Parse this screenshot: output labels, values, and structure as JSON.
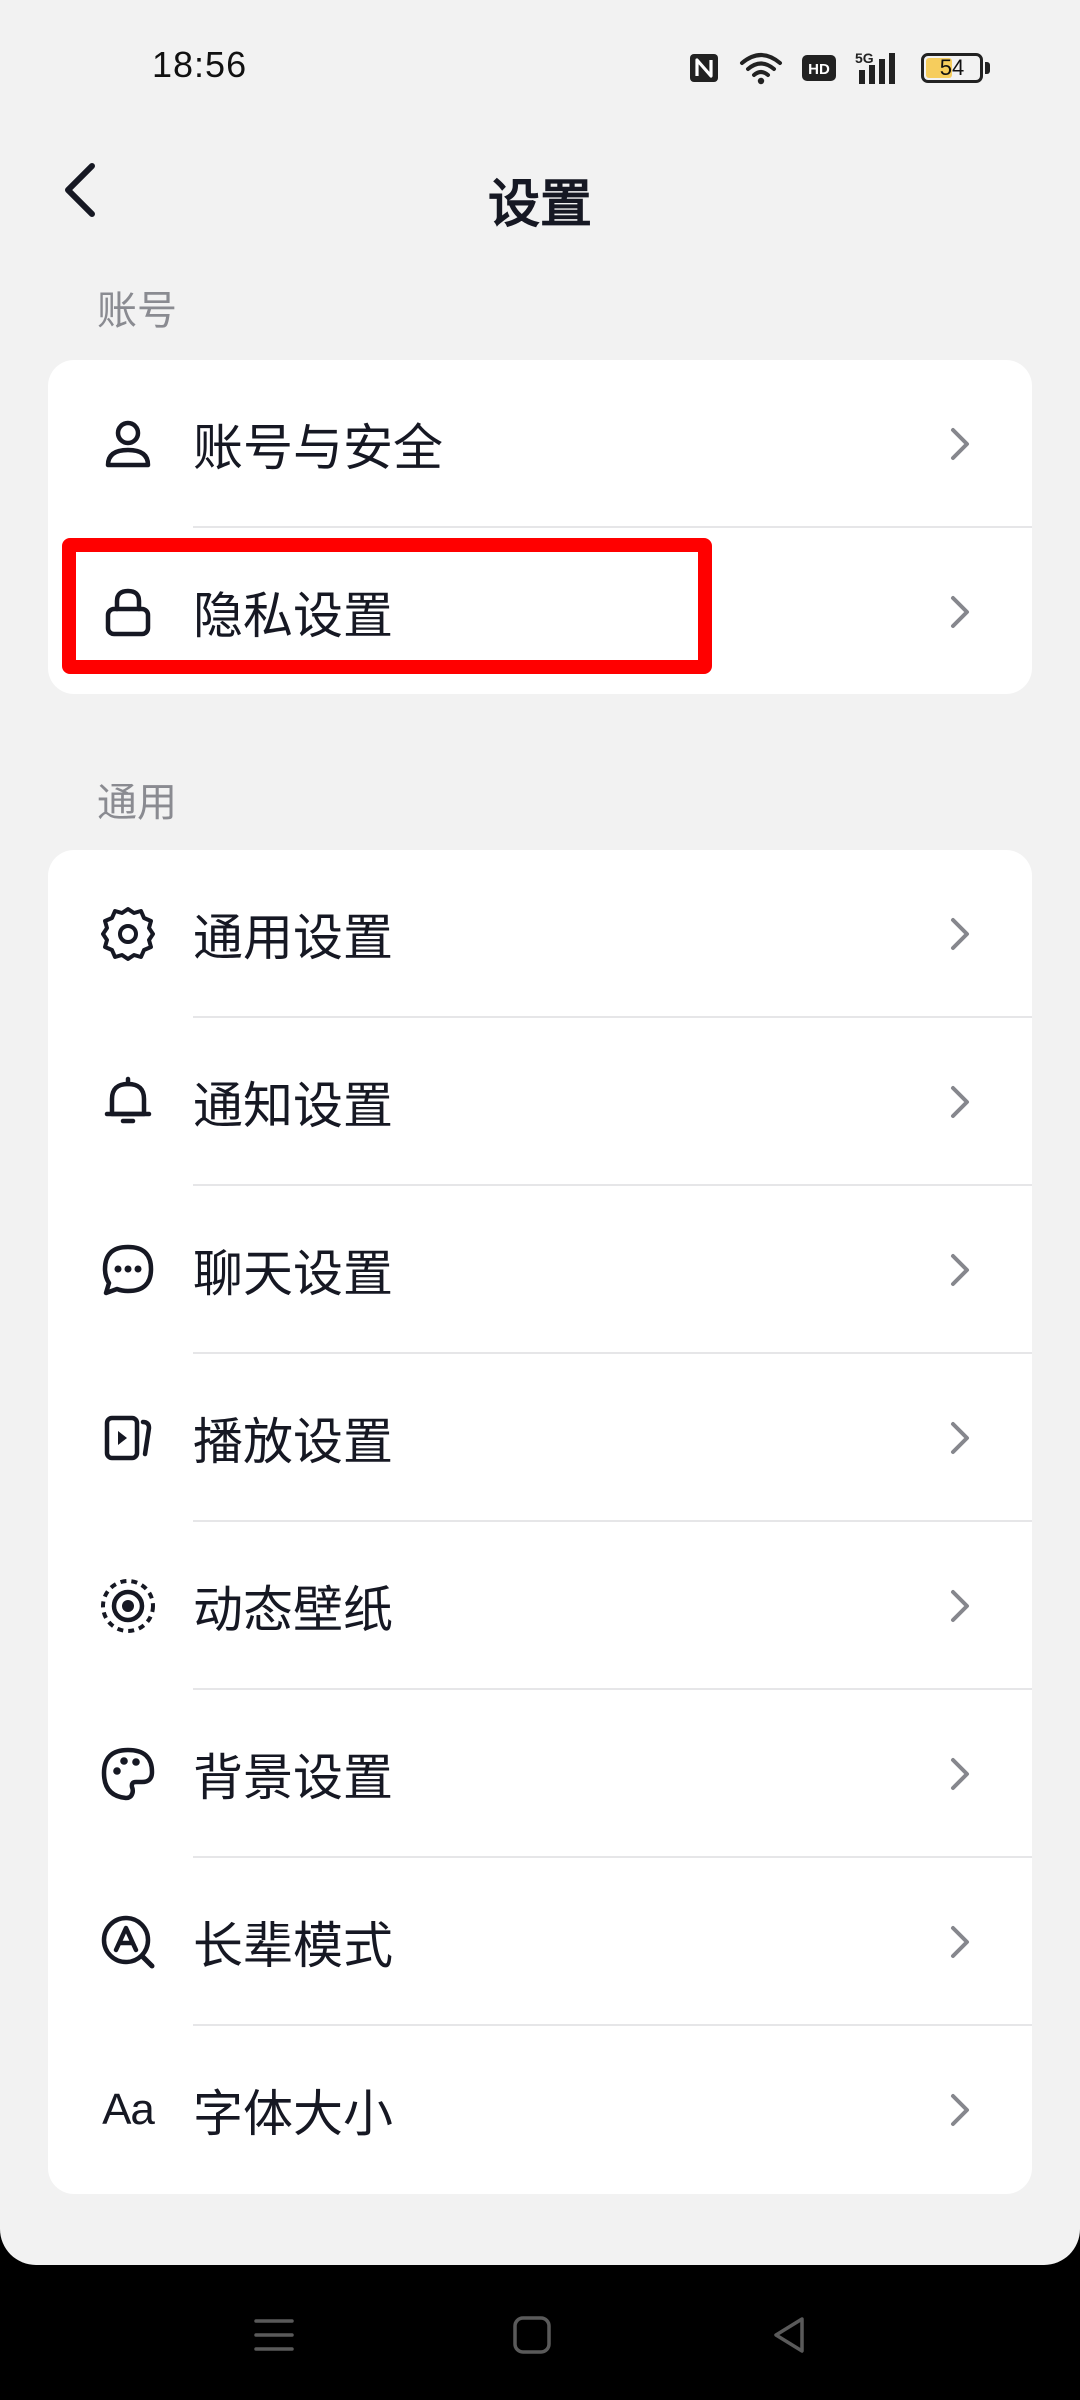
{
  "status_bar": {
    "time": "18:56",
    "battery_level": "54",
    "network_label": "5G",
    "hd_label": "HD",
    "icons": [
      "nfc-icon",
      "wifi-icon",
      "hd-icon",
      "signal-5g-icon",
      "battery-icon"
    ]
  },
  "header": {
    "title": "设置",
    "back_icon": "chevron-left-icon"
  },
  "sections": {
    "account": {
      "label": "账号",
      "items": [
        {
          "label": "账号与安全",
          "icon": "user-icon"
        },
        {
          "label": "隐私设置",
          "icon": "lock-icon"
        }
      ]
    },
    "general": {
      "label": "通用",
      "items": [
        {
          "label": "通用设置",
          "icon": "gear-icon"
        },
        {
          "label": "通知设置",
          "icon": "bell-icon"
        },
        {
          "label": "聊天设置",
          "icon": "chat-bubble-icon"
        },
        {
          "label": "播放设置",
          "icon": "play-screen-icon"
        },
        {
          "label": "动态壁纸",
          "icon": "live-wallpaper-icon"
        },
        {
          "label": "背景设置",
          "icon": "palette-icon"
        },
        {
          "label": "长辈模式",
          "icon": "elder-mode-icon"
        },
        {
          "label": "字体大小",
          "icon": "font-size-icon",
          "glyph": "Aa"
        }
      ]
    }
  },
  "nav_bar": {
    "icons": [
      "menu-icon",
      "home-icon",
      "back-triangle-icon"
    ]
  },
  "colors": {
    "page_bg": "#f2f2f2",
    "card_bg": "#ffffff",
    "text_primary": "#161823",
    "text_secondary": "#8a8b91",
    "highlight": "#ff0000",
    "battery_fill": "#f6cd5d"
  }
}
